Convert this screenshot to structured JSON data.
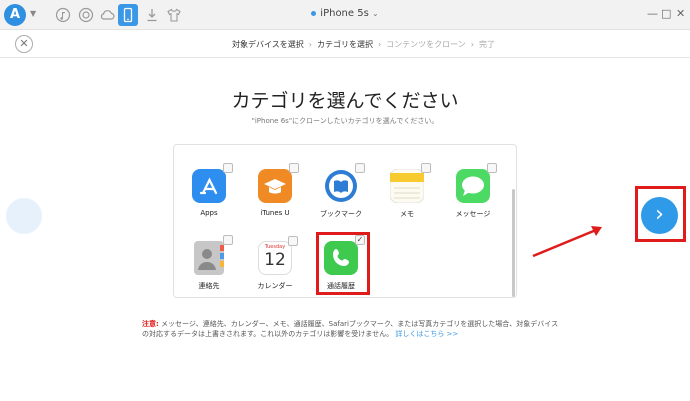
{
  "app": {
    "logo_letter": "A"
  },
  "device": {
    "name": "iPhone 5s"
  },
  "window_controls": {
    "minimize": "—",
    "maximize": "□",
    "close": "✕"
  },
  "toolbar": {
    "tools": [
      "music-icon",
      "clock-icon",
      "cloud-icon",
      "phone-icon",
      "download-icon",
      "shirt-icon"
    ],
    "active": "phone-icon"
  },
  "steps": {
    "items": [
      "対象デバイスを選択",
      "カテゴリを選択",
      "コンテンツをクローン",
      "完了"
    ],
    "separator": "›",
    "current": "カテゴリを選択"
  },
  "page": {
    "title": "カテゴリを選んでください",
    "subtitle": "\"iPhone 6s\"にクローンしたいカテゴリを選んでください。"
  },
  "categories": [
    {
      "label": "Apps",
      "checked": false,
      "icon": "app-store-icon"
    },
    {
      "label": "iTunes U",
      "checked": false,
      "icon": "itunes-u-icon"
    },
    {
      "label": "ブックマーク",
      "checked": false,
      "icon": "ibooks-icon"
    },
    {
      "label": "メモ",
      "checked": false,
      "icon": "notes-icon"
    },
    {
      "label": "メッセージ",
      "checked": false,
      "icon": "messages-icon"
    },
    {
      "label": "連絡先",
      "checked": false,
      "icon": "contacts-icon"
    },
    {
      "label": "カレンダー",
      "checked": false,
      "icon": "calendar-icon",
      "calendar_day": "Tuesday",
      "calendar_date": "12"
    },
    {
      "label": "通話履歴",
      "checked": true,
      "icon": "phone-call-icon"
    }
  ],
  "note": {
    "label": "注意:",
    "text": "メッセージ、連絡先、カレンダー、メモ、通話履歴、Safariブックマーク、または写真カテゴリを選択した場合、対象デバイスの対応するデータは上書きされます。これ以外のカテゴリは影響を受けません。",
    "link": "詳しくはこちら >>"
  },
  "nav": {
    "next_icon": "›"
  },
  "colors": {
    "accent": "#2f9ae8",
    "highlight": "#e01b1b"
  }
}
